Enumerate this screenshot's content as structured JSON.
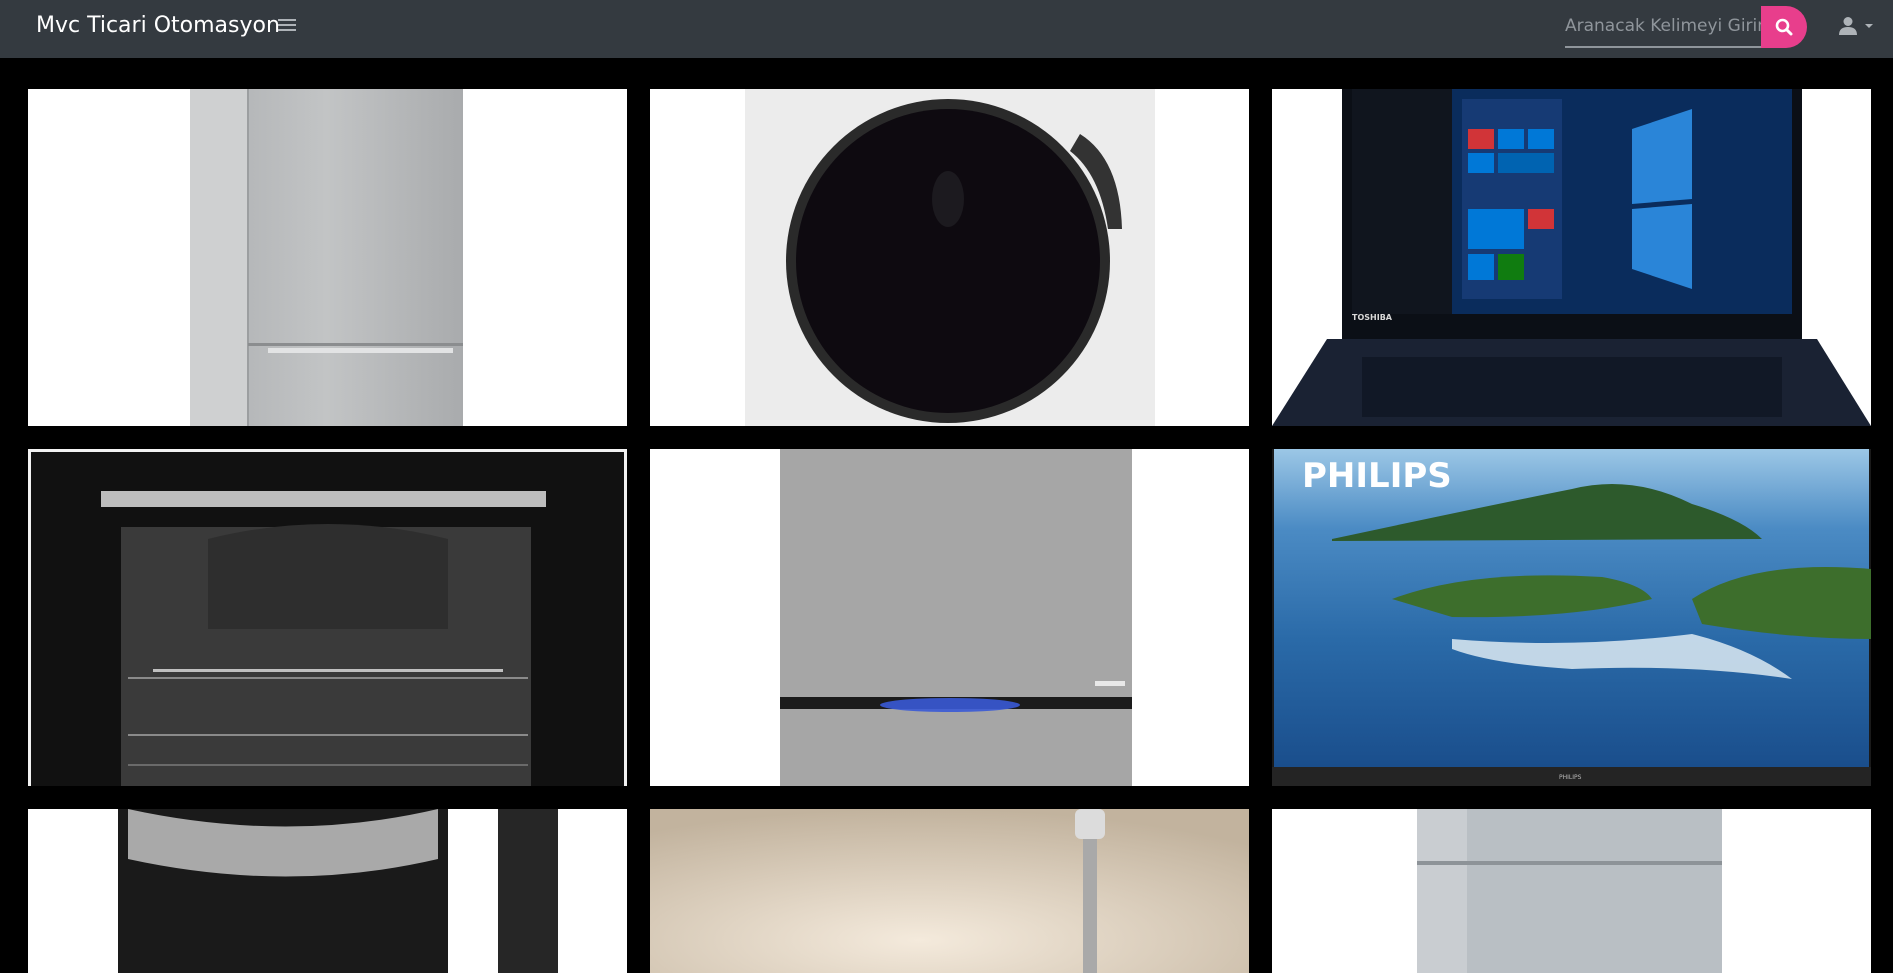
{
  "header": {
    "brand": "Mvc Ticari Otomasyon",
    "search_placeholder": "Aranacak Kelimeyi Girin",
    "search_icon": "search-icon",
    "menu_icon": "hamburger-icon",
    "user_icon": "user-icon"
  },
  "products": [
    {
      "name": "refrigerator-silver-1"
    },
    {
      "name": "washing-machine-door"
    },
    {
      "name": "toshiba-laptop",
      "brand_label": "TOSHIBA"
    },
    {
      "name": "built-in-oven"
    },
    {
      "name": "refrigerator-silver-2"
    },
    {
      "name": "philips-tv",
      "brand_label": "PHILIPS",
      "stand_label": "PHILIPS"
    },
    {
      "name": "kettle"
    },
    {
      "name": "floor-lamp"
    },
    {
      "name": "refrigerator-silver-3"
    }
  ],
  "colors": {
    "header_bg": "#343a40",
    "accent": "#e83e8c",
    "page_bg": "#000000"
  }
}
